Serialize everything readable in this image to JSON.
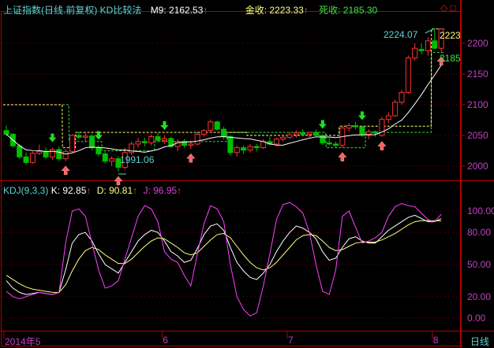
{
  "header": {
    "title": "上证指数(日线.前复权) KD比较法",
    "m9_label": "M9: 2162.53",
    "gold_label": "金收: 2223.33",
    "dead_label": "死收: 2185.30",
    "up_arrow": "↑",
    "icons": [
      "diamond-icon",
      "square-icon"
    ]
  },
  "kdj_header": {
    "name": "KDJ(9,3,3)",
    "k_label": "K: 92.85",
    "d_label": "D: 90.81",
    "j_label": "J: 96.95",
    "up_arrow": "↑"
  },
  "annotations": {
    "high": "2224.07",
    "low": "1991.06",
    "right_gold": "2223",
    "right_dead": "2185"
  },
  "x_axis": {
    "labels": [
      {
        "text": "2014年5",
        "i": 0
      },
      {
        "text": "6",
        "i": 24
      },
      {
        "text": "7",
        "i": 43
      },
      {
        "text": "8",
        "i": 65
      }
    ]
  },
  "period_label": "日线",
  "colors": {
    "up": "#ff3232",
    "down": "#00c000",
    "k": "#ffffff",
    "d": "#ffff80",
    "j": "#ff40ff",
    "axis": "#c040c0",
    "frame": "#b00000",
    "title": "#60d0d0"
  },
  "chart_data": [
    {
      "type": "candlestick",
      "title": "上证指数(日线.前复权) KD比较法",
      "ylim": [
        1980,
        2240
      ],
      "yticks": [
        2000,
        2050,
        2100,
        2150,
        2200
      ],
      "grid": true,
      "ohlc": [
        [
          2058,
          2066,
          2050,
          2052
        ],
        [
          2052,
          2054,
          2030,
          2033
        ],
        [
          2033,
          2036,
          2012,
          2015
        ],
        [
          2015,
          2022,
          2003,
          2006
        ],
        [
          2006,
          2024,
          2004,
          2021
        ],
        [
          2021,
          2035,
          2018,
          2024
        ],
        [
          2024,
          2030,
          2012,
          2015
        ],
        [
          2015,
          2030,
          2010,
          2027
        ],
        [
          2027,
          2032,
          2008,
          2012
        ],
        [
          2012,
          2028,
          2008,
          2024
        ],
        [
          2024,
          2052,
          2022,
          2050
        ],
        [
          2050,
          2056,
          2044,
          2047
        ],
        [
          2047,
          2054,
          2040,
          2049
        ],
        [
          2049,
          2052,
          2026,
          2030
        ],
        [
          2030,
          2034,
          2016,
          2020
        ],
        [
          2020,
          2024,
          2004,
          2008
        ],
        [
          2008,
          2016,
          2000,
          2012
        ],
        [
          2012,
          2016,
          1991.06,
          1998
        ],
        [
          1998,
          2030,
          1995,
          2022
        ],
        [
          2022,
          2040,
          2018,
          2036
        ],
        [
          2036,
          2046,
          2030,
          2040
        ],
        [
          2040,
          2046,
          2032,
          2038
        ],
        [
          2038,
          2052,
          2034,
          2048
        ],
        [
          2048,
          2054,
          2040,
          2042
        ],
        [
          2042,
          2050,
          2036,
          2045
        ],
        [
          2045,
          2048,
          2030,
          2032
        ],
        [
          2032,
          2044,
          2024,
          2040
        ],
        [
          2040,
          2044,
          2030,
          2034
        ],
        [
          2034,
          2040,
          2028,
          2036
        ],
        [
          2036,
          2056,
          2034,
          2052
        ],
        [
          2052,
          2060,
          2048,
          2058
        ],
        [
          2058,
          2076,
          2054,
          2072
        ],
        [
          2072,
          2074,
          2058,
          2060
        ],
        [
          2060,
          2064,
          2044,
          2048
        ],
        [
          2048,
          2050,
          2018,
          2022
        ],
        [
          2022,
          2034,
          2016,
          2030
        ],
        [
          2030,
          2034,
          2020,
          2026
        ],
        [
          2026,
          2036,
          2022,
          2032
        ],
        [
          2032,
          2036,
          2024,
          2030
        ],
        [
          2030,
          2044,
          2028,
          2040
        ],
        [
          2040,
          2048,
          2034,
          2036
        ],
        [
          2036,
          2046,
          2032,
          2044
        ],
        [
          2044,
          2050,
          2040,
          2047
        ],
        [
          2047,
          2055,
          2044,
          2051
        ],
        [
          2051,
          2058,
          2046,
          2054
        ],
        [
          2054,
          2060,
          2050,
          2052
        ],
        [
          2052,
          2056,
          2046,
          2055
        ],
        [
          2055,
          2060,
          2048,
          2050
        ],
        [
          2050,
          2052,
          2034,
          2038
        ],
        [
          2038,
          2046,
          2034,
          2036
        ],
        [
          2036,
          2040,
          2030,
          2034
        ],
        [
          2034,
          2066,
          2030,
          2062
        ],
        [
          2062,
          2070,
          2056,
          2066
        ],
        [
          2066,
          2072,
          2060,
          2064
        ],
        [
          2064,
          2066,
          2048,
          2052
        ],
        [
          2052,
          2060,
          2044,
          2056
        ],
        [
          2056,
          2058,
          2048,
          2054
        ],
        [
          2050,
          2080,
          2048,
          2076
        ],
        [
          2076,
          2088,
          2070,
          2082
        ],
        [
          2082,
          2108,
          2080,
          2104
        ],
        [
          2104,
          2124,
          2100,
          2120
        ],
        [
          2120,
          2180,
          2118,
          2176
        ],
        [
          2176,
          2200,
          2172,
          2192
        ],
        [
          2190,
          2200,
          2182,
          2188
        ],
        [
          2188,
          2210,
          2180,
          2204
        ],
        [
          2204,
          2224.07,
          2190,
          2192
        ],
        [
          2192,
          2223.5,
          2186,
          2223.33
        ]
      ],
      "gold_line": [
        [
          0,
          8,
          2100
        ],
        [
          9,
          10,
          2030
        ],
        [
          11,
          36,
          2055
        ],
        [
          37,
          50,
          2050
        ],
        [
          51,
          64,
          2065
        ],
        [
          65,
          66,
          2223.33
        ]
      ],
      "dead_line": [
        [
          0,
          9,
          2100
        ],
        [
          10,
          14,
          2040
        ],
        [
          15,
          22,
          2025
        ],
        [
          23,
          33,
          2040
        ],
        [
          34,
          48,
          2055
        ],
        [
          49,
          54,
          2030
        ],
        [
          55,
          64,
          2055
        ],
        [
          65,
          66,
          2185.3
        ]
      ],
      "sell_signals": [
        7,
        14,
        24,
        48,
        54
      ],
      "buy_signals": [
        9,
        17,
        28,
        51,
        57,
        66
      ]
    },
    {
      "type": "line",
      "title": "KDJ(9,3,3)",
      "ylim": [
        -10,
        115
      ],
      "yticks": [
        "100.00",
        "80.00",
        "50.00",
        "20.00",
        "0.00"
      ],
      "series": [
        {
          "name": "K",
          "values": [
            35,
            28,
            24,
            22,
            23,
            24,
            23,
            22,
            24,
            45,
            70,
            78,
            80,
            72,
            60,
            50,
            46,
            42,
            52,
            62,
            72,
            78,
            82,
            80,
            72,
            62,
            58,
            52,
            54,
            65,
            78,
            86,
            88,
            82,
            66,
            52,
            44,
            38,
            36,
            42,
            50,
            62,
            72,
            80,
            86,
            84,
            80,
            74,
            62,
            54,
            56,
            66,
            74,
            76,
            72,
            70,
            70,
            76,
            82,
            86,
            90,
            94,
            96,
            93,
            90,
            90,
            92.85
          ]
        },
        {
          "name": "D",
          "values": [
            40,
            36,
            32,
            29,
            27,
            26,
            25,
            24,
            24,
            31,
            44,
            55,
            63,
            66,
            64,
            59,
            55,
            51,
            51,
            55,
            61,
            67,
            72,
            75,
            74,
            70,
            66,
            61,
            59,
            61,
            67,
            73,
            78,
            79,
            75,
            67,
            59,
            52,
            47,
            45,
            47,
            52,
            59,
            66,
            73,
            77,
            78,
            77,
            72,
            66,
            63,
            64,
            67,
            70,
            71,
            71,
            71,
            73,
            76,
            79,
            83,
            87,
            90,
            91,
            91,
            91,
            90.81
          ]
        },
        {
          "name": "J",
          "values": [
            25,
            20,
            18,
            20,
            22,
            24,
            23,
            22,
            24,
            70,
            100,
            102,
            95,
            70,
            45,
            28,
            30,
            35,
            55,
            75,
            95,
            105,
            102,
            90,
            62,
            55,
            52,
            40,
            30,
            60,
            88,
            105,
            102,
            90,
            50,
            20,
            8,
            2,
            5,
            30,
            60,
            92,
            106,
            108,
            104,
            98,
            80,
            50,
            25,
            22,
            45,
            95,
            100,
            85,
            70,
            72,
            75,
            80,
            95,
            104,
            107,
            105,
            104,
            98,
            92,
            90,
            96.95
          ]
        }
      ]
    }
  ]
}
